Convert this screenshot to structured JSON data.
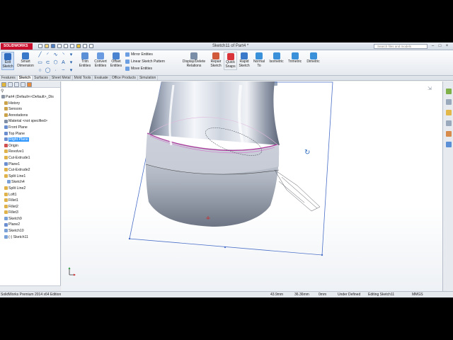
{
  "app": {
    "logo_text": "SOLIDWORKS",
    "document_title": "Sketch11 of Part4 *",
    "search_placeholder": "Search files and models",
    "window_controls": [
      "–",
      "□",
      "×"
    ]
  },
  "ribbon": {
    "exit_sketch": [
      "Exit",
      "Sketch"
    ],
    "smart_dimension": [
      "Smart",
      "Dimension"
    ],
    "trim_entities": [
      "Trim",
      "Entities"
    ],
    "convert_entities": [
      "Convert",
      "Entities"
    ],
    "offset_entities": [
      "Offset",
      "Entities"
    ],
    "mirror_entities": "Mirror Entities",
    "linear_sketch_pattern": "Linear Sketch Pattern",
    "move_entities": "Move Entities",
    "display_delete_relations": [
      "Display/Delete",
      "Relations"
    ],
    "repair_sketch": [
      "Repair",
      "Sketch"
    ],
    "quick_snaps": [
      "Quick",
      "Snaps"
    ],
    "rapid_sketch": [
      "Rapid",
      "Sketch"
    ],
    "normal_to": [
      "Normal",
      "To"
    ],
    "isometric": "Isometric",
    "trimetric": "Trimetric",
    "dimetric": "Dimetric"
  },
  "tabs": [
    "Features",
    "Sketch",
    "Surfaces",
    "Sheet Metal",
    "Mold Tools",
    "Evaluate",
    "Office Products",
    "Simulation"
  ],
  "active_tab": "Sketch",
  "tree": [
    {
      "label": "Part4  (Default<<Default>_Dis",
      "level": 0,
      "icon": "part-icon"
    },
    {
      "label": "History",
      "level": 1,
      "icon": "history-icon"
    },
    {
      "label": "Sensors",
      "level": 1,
      "icon": "sensor-icon"
    },
    {
      "label": "Annotations",
      "level": 1,
      "icon": "annotation-icon"
    },
    {
      "label": "Material <not specified>",
      "level": 1,
      "icon": "material-icon"
    },
    {
      "label": "Front Plane",
      "level": 1,
      "icon": "plane-icon"
    },
    {
      "label": "Top Plane",
      "level": 1,
      "icon": "plane-icon"
    },
    {
      "label": "Right Plane",
      "level": 1,
      "icon": "plane-icon",
      "selected": true
    },
    {
      "label": "Origin",
      "level": 1,
      "icon": "origin-icon"
    },
    {
      "label": "Revolve1",
      "level": 1,
      "icon": "revolve-icon"
    },
    {
      "label": "Cut-Extrude1",
      "level": 1,
      "icon": "cut-icon"
    },
    {
      "label": "Plane1",
      "level": 1,
      "icon": "plane-icon"
    },
    {
      "label": "Cut-Extrude2",
      "level": 1,
      "icon": "cut-icon"
    },
    {
      "label": "Split Line1",
      "level": 1,
      "icon": "split-line-icon"
    },
    {
      "label": "Sketch4",
      "level": 2,
      "icon": "sketch-icon"
    },
    {
      "label": "Split Line2",
      "level": 1,
      "icon": "split-line-icon"
    },
    {
      "label": "Loft1",
      "level": 1,
      "icon": "loft-icon"
    },
    {
      "label": "Fillet1",
      "level": 1,
      "icon": "fillet-icon"
    },
    {
      "label": "Fillet2",
      "level": 1,
      "icon": "fillet-icon"
    },
    {
      "label": "Fillet3",
      "level": 1,
      "icon": "fillet-icon"
    },
    {
      "label": "Sketch9",
      "level": 1,
      "icon": "sketch-icon"
    },
    {
      "label": "Plane2",
      "level": 1,
      "icon": "plane-icon"
    },
    {
      "label": "Sketch10",
      "level": 1,
      "icon": "sketch-icon"
    },
    {
      "label": "(-) Sketch11",
      "level": 1,
      "icon": "sketch-icon"
    }
  ],
  "status": {
    "edition": "SolidWorks Premium 2014 x64 Edition",
    "x": "43.9mm",
    "y": "36.36mm",
    "z": "0mm",
    "definition": "Under Defined",
    "editing": "Editing Sketch11",
    "units": "MMGS"
  },
  "colors": {
    "accent_blue": "#1d5aa8",
    "selection": "#3399ff",
    "sketch_magenta": "#b0309a",
    "plane_blue": "#4a6fc8",
    "logo_red": "#c8102e"
  }
}
